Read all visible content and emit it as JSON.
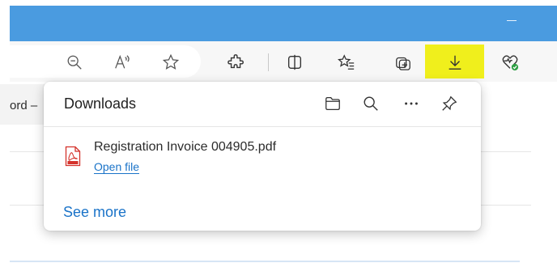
{
  "background_tab": {
    "text": "ord –"
  },
  "downloads_panel": {
    "title": "Downloads",
    "item": {
      "file_name": "Registration Invoice 004905.pdf",
      "action_label": "Open file",
      "file_icon": "pdf-file-icon"
    },
    "see_more_label": "See more",
    "header_icons": [
      "folder-icon",
      "search-icon",
      "more-options-icon",
      "pin-icon"
    ]
  },
  "toolbar_icons": [
    "zoom-out-icon",
    "read-aloud-icon",
    "favorite-star-icon",
    "extensions-icon",
    "split-screen-icon",
    "favorites-icon",
    "collections-icon",
    "downloads-icon",
    "browser-essentials-icon"
  ],
  "colors": {
    "title_bar": "#4a9be0",
    "toolbar": "#f7f7f7",
    "download_highlight": "#f0ef1c",
    "link": "#1a73c8",
    "pdf_red": "#d4322b",
    "health_green": "#2e9e44"
  }
}
